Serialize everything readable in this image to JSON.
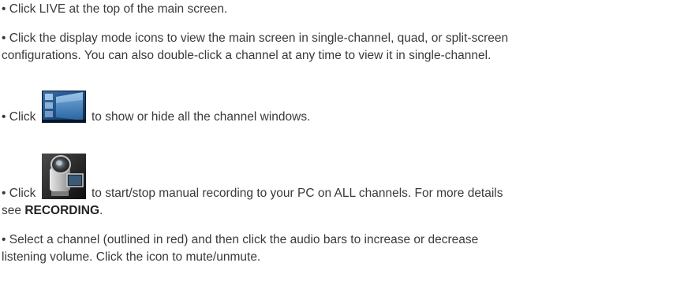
{
  "instructions": {
    "item1": {
      "bullet": "•",
      "text": "Click LIVE at the top of the main screen."
    },
    "item2": {
      "bullet": "•",
      "line1": "Click the display mode icons to view the main screen in single-channel, quad, or split-screen",
      "line2": "configurations. You can also double-click a channel at any time to view it in single-channel."
    },
    "item3": {
      "bullet": "•",
      "before": "Click",
      "icon": "channel-windows-icon",
      "after": "to show or hide all the channel windows."
    },
    "item4": {
      "bullet": "•",
      "before": "Click",
      "icon": "camcorder-record-icon",
      "after": "to start/stop manual recording to your PC on ALL channels. For more details",
      "line2_prefix": "see",
      "line2_bold": "RECORDING",
      "line2_suffix": "."
    },
    "item5": {
      "bullet": "•",
      "line1": "Select a channel (outlined in red) and then click the audio bars to increase or decrease",
      "line2": "listening volume. Click the icon to mute/unmute."
    }
  }
}
